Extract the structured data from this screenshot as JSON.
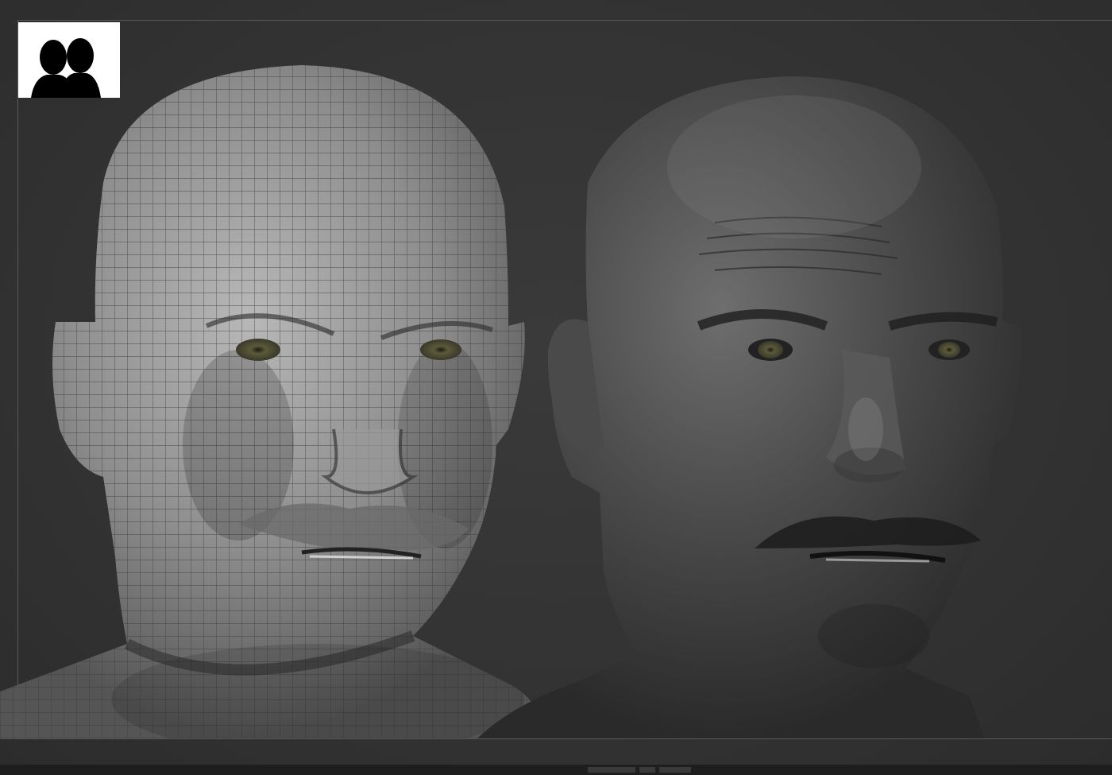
{
  "viewport": {
    "background": "#333333",
    "frame_color": "#5a5a5a"
  },
  "thumbnail": {
    "icon": "two-heads-silhouette-icon",
    "background": "#ffffff"
  },
  "models": [
    {
      "name": "wireframe-head",
      "render": "polygroup-wireframe",
      "color": "#8a8a8a"
    },
    {
      "name": "sculpted-head",
      "render": "matcap-sculpt",
      "color": "#4a4a4a"
    }
  ]
}
